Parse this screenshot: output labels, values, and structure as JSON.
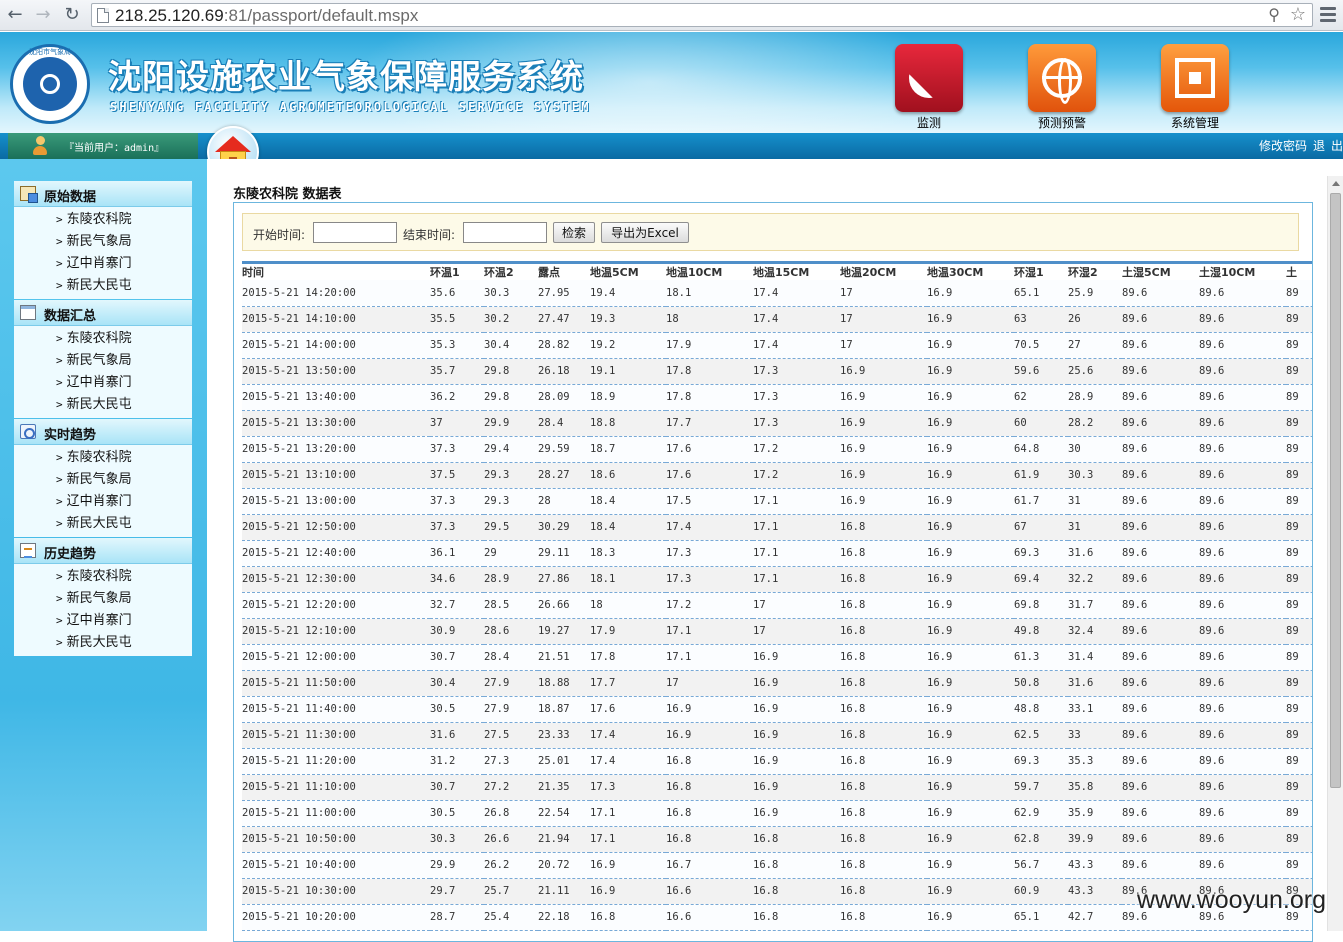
{
  "browser": {
    "url_host": "218.25.120.69",
    "url_path": ":81/passport/default.mspx"
  },
  "header": {
    "title": "沈阳设施农业气象保障服务系统",
    "subtitle": "SHENYANG FACILITY AGROMETEOROLOGICAL SERVICE SYSTEM",
    "logo_text": "沈阳市气象局",
    "nav": [
      {
        "label": "监测",
        "color": "#c4142b",
        "icon": "satellite-dish-icon"
      },
      {
        "label": "预测预警",
        "color": "#ee6a14",
        "icon": "globe-icon"
      },
      {
        "label": "系统管理",
        "color": "#ef6b12",
        "icon": "chip-icon"
      }
    ]
  },
  "userbar": {
    "label": "『当前用户：admin』"
  },
  "top_links": {
    "change_password": "修改密码",
    "logout_1": "退",
    "logout_2": "出"
  },
  "sidebar": {
    "sections": [
      {
        "title": "原始数据",
        "items": [
          "东陵农科院",
          "新民气象局",
          "辽中肖寨门",
          "新民大民屯"
        ]
      },
      {
        "title": "数据汇总",
        "items": [
          "东陵农科院",
          "新民气象局",
          "辽中肖寨门",
          "新民大民屯"
        ]
      },
      {
        "title": "实时趋势",
        "items": [
          "东陵农科院",
          "新民气象局",
          "辽中肖寨门",
          "新民大民屯"
        ]
      },
      {
        "title": "历史趋势",
        "items": [
          "东陵农科院",
          "新民气象局",
          "辽中肖寨门",
          "新民大民屯"
        ]
      }
    ]
  },
  "main": {
    "heading": "东陵农科院 数据表",
    "filter": {
      "start_label": "开始时间:",
      "end_label": "结束时间:",
      "start_value": "",
      "end_value": "",
      "search_label": "检索",
      "export_label": "导出为Excel"
    },
    "table": {
      "columns": [
        "时间",
        "环温1",
        "环温2",
        "露点",
        "地温5CM",
        "地温10CM",
        "地温15CM",
        "地温20CM",
        "地温30CM",
        "环湿1",
        "环湿2",
        "土湿5CM",
        "土湿10CM",
        "土"
      ],
      "rows": [
        [
          "2015-5-21 14:20:00",
          "35.6",
          "30.3",
          "27.95",
          "19.4",
          "18.1",
          "17.4",
          "17",
          "16.9",
          "65.1",
          "25.9",
          "89.6",
          "89.6",
          "89"
        ],
        [
          "2015-5-21 14:10:00",
          "35.5",
          "30.2",
          "27.47",
          "19.3",
          "18",
          "17.4",
          "17",
          "16.9",
          "63",
          "26",
          "89.6",
          "89.6",
          "89"
        ],
        [
          "2015-5-21 14:00:00",
          "35.3",
          "30.4",
          "28.82",
          "19.2",
          "17.9",
          "17.4",
          "17",
          "16.9",
          "70.5",
          "27",
          "89.6",
          "89.6",
          "89"
        ],
        [
          "2015-5-21 13:50:00",
          "35.7",
          "29.8",
          "26.18",
          "19.1",
          "17.8",
          "17.3",
          "16.9",
          "16.9",
          "59.6",
          "25.6",
          "89.6",
          "89.6",
          "89"
        ],
        [
          "2015-5-21 13:40:00",
          "36.2",
          "29.8",
          "28.09",
          "18.9",
          "17.8",
          "17.3",
          "16.9",
          "16.9",
          "62",
          "28.9",
          "89.6",
          "89.6",
          "89"
        ],
        [
          "2015-5-21 13:30:00",
          "37",
          "29.9",
          "28.4",
          "18.8",
          "17.7",
          "17.3",
          "16.9",
          "16.9",
          "60",
          "28.2",
          "89.6",
          "89.6",
          "89"
        ],
        [
          "2015-5-21 13:20:00",
          "37.3",
          "29.4",
          "29.59",
          "18.7",
          "17.6",
          "17.2",
          "16.9",
          "16.9",
          "64.8",
          "30",
          "89.6",
          "89.6",
          "89"
        ],
        [
          "2015-5-21 13:10:00",
          "37.5",
          "29.3",
          "28.27",
          "18.6",
          "17.6",
          "17.2",
          "16.9",
          "16.9",
          "61.9",
          "30.3",
          "89.6",
          "89.6",
          "89"
        ],
        [
          "2015-5-21 13:00:00",
          "37.3",
          "29.3",
          "28",
          "18.4",
          "17.5",
          "17.1",
          "16.9",
          "16.9",
          "61.7",
          "31",
          "89.6",
          "89.6",
          "89"
        ],
        [
          "2015-5-21 12:50:00",
          "37.3",
          "29.5",
          "30.29",
          "18.4",
          "17.4",
          "17.1",
          "16.8",
          "16.9",
          "67",
          "31",
          "89.6",
          "89.6",
          "89"
        ],
        [
          "2015-5-21 12:40:00",
          "36.1",
          "29",
          "29.11",
          "18.3",
          "17.3",
          "17.1",
          "16.8",
          "16.9",
          "69.3",
          "31.6",
          "89.6",
          "89.6",
          "89"
        ],
        [
          "2015-5-21 12:30:00",
          "34.6",
          "28.9",
          "27.86",
          "18.1",
          "17.3",
          "17.1",
          "16.8",
          "16.9",
          "69.4",
          "32.2",
          "89.6",
          "89.6",
          "89"
        ],
        [
          "2015-5-21 12:20:00",
          "32.7",
          "28.5",
          "26.66",
          "18",
          "17.2",
          "17",
          "16.8",
          "16.9",
          "69.8",
          "31.7",
          "89.6",
          "89.6",
          "89"
        ],
        [
          "2015-5-21 12:10:00",
          "30.9",
          "28.6",
          "19.27",
          "17.9",
          "17.1",
          "17",
          "16.8",
          "16.9",
          "49.8",
          "32.4",
          "89.6",
          "89.6",
          "89"
        ],
        [
          "2015-5-21 12:00:00",
          "30.7",
          "28.4",
          "21.51",
          "17.8",
          "17.1",
          "16.9",
          "16.8",
          "16.9",
          "61.3",
          "31.4",
          "89.6",
          "89.6",
          "89"
        ],
        [
          "2015-5-21 11:50:00",
          "30.4",
          "27.9",
          "18.88",
          "17.7",
          "17",
          "16.9",
          "16.8",
          "16.9",
          "50.8",
          "31.6",
          "89.6",
          "89.6",
          "89"
        ],
        [
          "2015-5-21 11:40:00",
          "30.5",
          "27.9",
          "18.87",
          "17.6",
          "16.9",
          "16.9",
          "16.8",
          "16.9",
          "48.8",
          "33.1",
          "89.6",
          "89.6",
          "89"
        ],
        [
          "2015-5-21 11:30:00",
          "31.6",
          "27.5",
          "23.33",
          "17.4",
          "16.9",
          "16.9",
          "16.8",
          "16.9",
          "62.5",
          "33",
          "89.6",
          "89.6",
          "89"
        ],
        [
          "2015-5-21 11:20:00",
          "31.2",
          "27.3",
          "25.01",
          "17.4",
          "16.8",
          "16.9",
          "16.8",
          "16.9",
          "69.3",
          "35.3",
          "89.6",
          "89.6",
          "89"
        ],
        [
          "2015-5-21 11:10:00",
          "30.7",
          "27.2",
          "21.35",
          "17.3",
          "16.8",
          "16.9",
          "16.8",
          "16.9",
          "59.7",
          "35.8",
          "89.6",
          "89.6",
          "89"
        ],
        [
          "2015-5-21 11:00:00",
          "30.5",
          "26.8",
          "22.54",
          "17.1",
          "16.8",
          "16.9",
          "16.8",
          "16.9",
          "62.9",
          "35.9",
          "89.6",
          "89.6",
          "89"
        ],
        [
          "2015-5-21 10:50:00",
          "30.3",
          "26.6",
          "21.94",
          "17.1",
          "16.8",
          "16.8",
          "16.8",
          "16.9",
          "62.8",
          "39.9",
          "89.6",
          "89.6",
          "89"
        ],
        [
          "2015-5-21 10:40:00",
          "29.9",
          "26.2",
          "20.72",
          "16.9",
          "16.7",
          "16.8",
          "16.8",
          "16.9",
          "56.7",
          "43.3",
          "89.6",
          "89.6",
          "89"
        ],
        [
          "2015-5-21 10:30:00",
          "29.7",
          "25.7",
          "21.11",
          "16.9",
          "16.6",
          "16.8",
          "16.8",
          "16.9",
          "60.9",
          "43.3",
          "89.6",
          "89.6",
          "89"
        ],
        [
          "2015-5-21 10:20:00",
          "28.7",
          "25.4",
          "22.18",
          "16.8",
          "16.6",
          "16.8",
          "16.8",
          "16.9",
          "65.1",
          "42.7",
          "89.6",
          "89.6",
          "89"
        ]
      ]
    }
  },
  "watermark": "www.wooyun.org"
}
